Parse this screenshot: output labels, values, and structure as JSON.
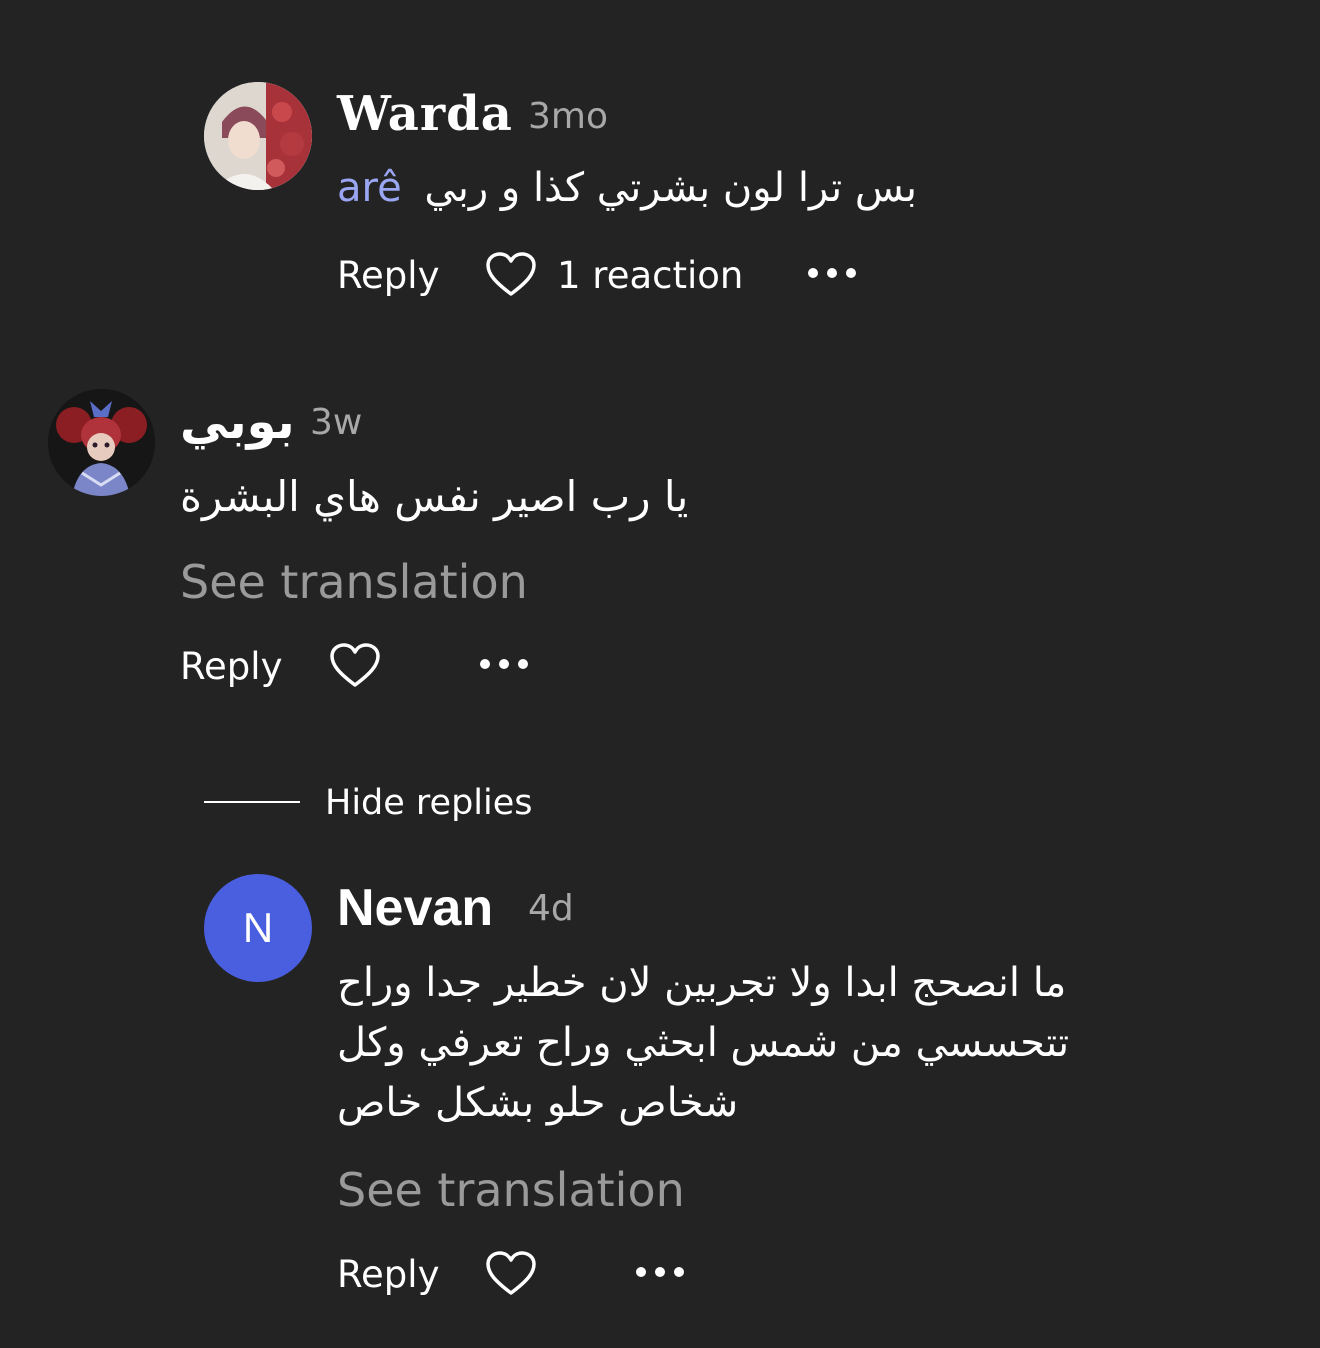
{
  "colors": {
    "background": "#232323",
    "text": "#ffffff",
    "muted": "#a8a8a8",
    "translation": "#9a9a9a",
    "mention": "#9aa6f2",
    "avatar_letter_bg": "#4a5fe0"
  },
  "actions": {
    "reply_label": "Reply",
    "like_icon": "heart-outline-icon",
    "more_icon": "ellipsis-icon"
  },
  "comments": [
    {
      "name": "Warda",
      "time": "3mo",
      "text": "بس ترا لون بشرتي كذا و ربي",
      "mention": "arê",
      "reactions": "1 reaction"
    },
    {
      "name": "بوبي",
      "time": "3w",
      "text": "يا رب اصير نفس هاي البشرة",
      "see_translation": "See translation"
    }
  ],
  "hide_replies": "Hide replies",
  "replies": [
    {
      "avatar_letter": "N",
      "name": "Nevan",
      "time": "4d",
      "lines": [
        "ما انصحج ابدا ولا تجربين لان خطير جدا وراح",
        "تتحسسي من شمس ابحثي وراح تعرفي وكل",
        "شخاص حلو بشكل خاص"
      ],
      "see_translation": "See translation"
    }
  ]
}
